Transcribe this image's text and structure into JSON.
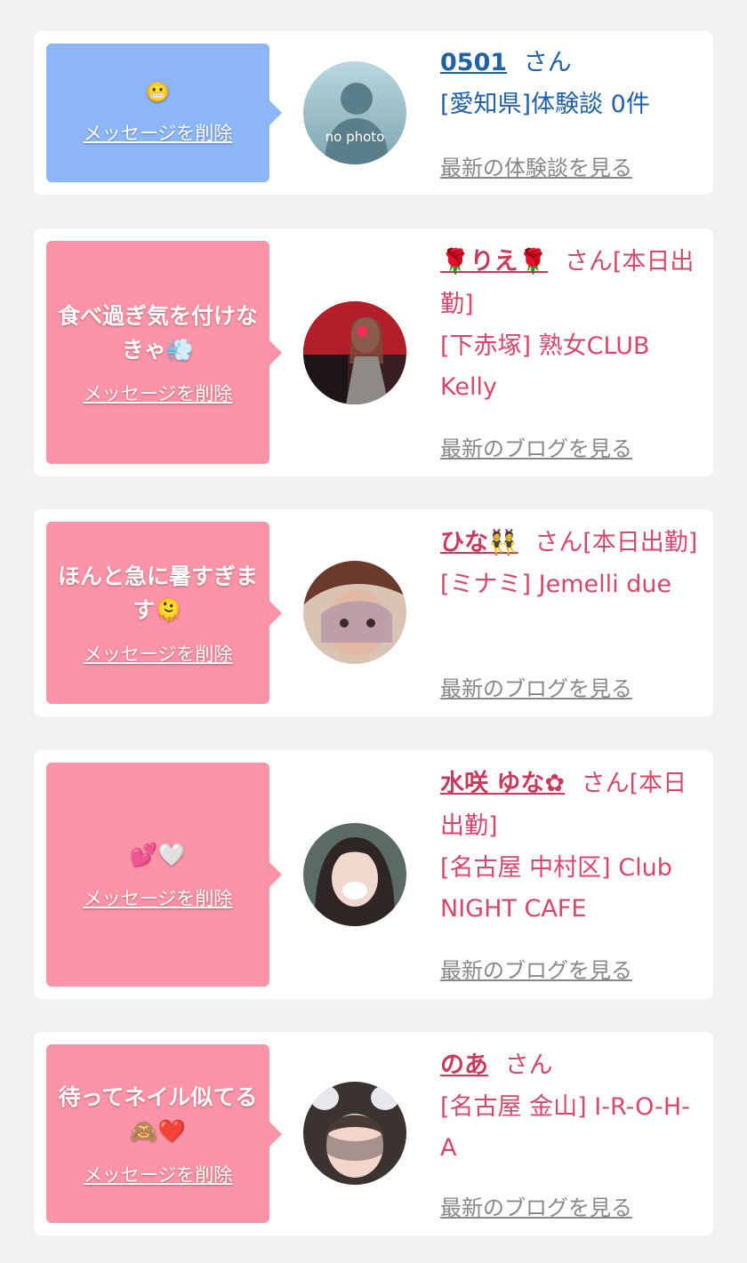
{
  "colors": {
    "page_bg": "#f2f2f2",
    "card_bg": "#ffffff",
    "bubble_blue": "#8cb6f5",
    "bubble_pink": "#fd93a6",
    "text_blue": "#1f61a8",
    "text_pink": "#d6486b",
    "link_gray": "#888888"
  },
  "delete_label": "メッセージを削除",
  "cards": [
    {
      "message": "😬",
      "name": "0501",
      "suffix": "さん",
      "shop": "[愛知県]体験談 0件",
      "link": "最新の体験談を見る",
      "avatar_text": "no photo",
      "avatar_icon": "person-silhouette-icon"
    },
    {
      "message": "食べ過ぎ気を付けなきゃ💨",
      "name": "🌹りえ🌹",
      "suffix": "さん[本日出勤]",
      "shop": "[下赤塚] 熟女CLUB Kelly",
      "link": "最新のブログを見る",
      "avatar_icon": "profile-photo"
    },
    {
      "message": "ほんと急に暑すぎます🫠",
      "name": "ひな👯",
      "suffix": "さん[本日出勤]",
      "shop": "[ミナミ] Jemelli due",
      "link": "最新のブログを見る",
      "avatar_icon": "profile-photo"
    },
    {
      "message": "💕🤍",
      "name": "水咲 ゆな✿",
      "suffix": "さん[本日出勤]",
      "shop": "[名古屋 中村区] Club NIGHT CAFE",
      "link": "最新のブログを見る",
      "avatar_icon": "profile-photo"
    },
    {
      "message": "待ってネイル似てる🙈❤️",
      "name": "のあ",
      "suffix": "さん",
      "shop": "[名古屋 金山] I-R-O-H-A",
      "link": "最新のブログを見る",
      "avatar_icon": "profile-photo"
    }
  ]
}
